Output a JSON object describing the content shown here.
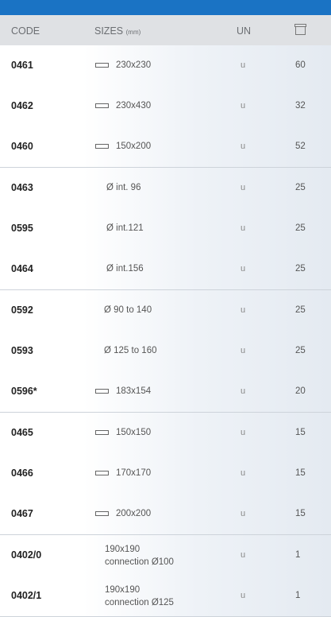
{
  "header": {
    "code": "CODE",
    "sizes": "SIZES",
    "sizes_unit": "(mm)",
    "un": "UN",
    "box_icon": "box-icon"
  },
  "groups": [
    [
      {
        "code": "0461",
        "size": "230x230",
        "icon": "rectangle-icon",
        "un": "u",
        "qty": "60"
      },
      {
        "code": "0462",
        "size": "230x430",
        "icon": "rectangle-icon",
        "un": "u",
        "qty": "32"
      },
      {
        "code": "0460",
        "size": "150x200",
        "icon": "rectangle-icon",
        "un": "u",
        "qty": "52"
      }
    ],
    [
      {
        "code": "0463",
        "size": "Ø int. 96",
        "un": "u",
        "qty": "25"
      },
      {
        "code": "0595",
        "size": "Ø int.121",
        "un": "u",
        "qty": "25"
      },
      {
        "code": "0464",
        "size": "Ø int.156",
        "un": "u",
        "qty": "25"
      }
    ],
    [
      {
        "code": "0592",
        "size": "Ø 90 to 140",
        "un": "u",
        "qty": "25"
      },
      {
        "code": "0593",
        "size": "Ø 125 to 160",
        "un": "u",
        "qty": "25"
      },
      {
        "code": "0596*",
        "size": "183x154",
        "icon": "rectangle-icon",
        "un": "u",
        "qty": "20"
      }
    ],
    [
      {
        "code": "0465",
        "size": "150x150",
        "icon": "rectangle-icon",
        "un": "u",
        "qty": "15"
      },
      {
        "code": "0466",
        "size": "170x170",
        "icon": "rectangle-icon",
        "un": "u",
        "qty": "15"
      },
      {
        "code": "0467",
        "size": "200x200",
        "icon": "rectangle-icon",
        "un": "u",
        "qty": "15"
      }
    ],
    [
      {
        "code": "0402/0",
        "size": "190x190",
        "size2": "connection Ø100",
        "un": "u",
        "qty": "1"
      },
      {
        "code": "0402/1",
        "size": "190x190",
        "size2": "connection Ø125",
        "un": "u",
        "qty": "1"
      }
    ]
  ]
}
